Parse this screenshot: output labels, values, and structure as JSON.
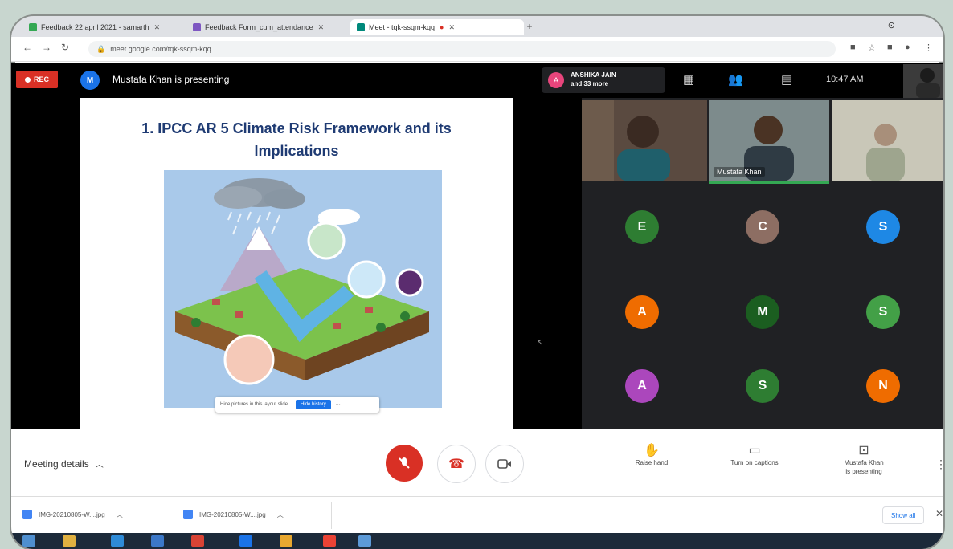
{
  "browser": {
    "tabs": [
      {
        "label": "Feedback 22 april 2021 - samarth",
        "fav": "#34a853"
      },
      {
        "label": "Feedback Form_cum_attendance",
        "fav": "#7e57c2"
      },
      {
        "label": "Meet - tqk-ssqm-kqq",
        "fav": "#00897b"
      }
    ],
    "url": "meet.google.com/tqk-ssqm-kqq"
  },
  "meet": {
    "rec_label": "REC",
    "presenter_initial": "M",
    "presenting_text": "Mustafa Khan is presenting",
    "chip_initial": "A",
    "chip_line1": "ANSHIKA JAIN",
    "chip_line2": "and 33 more",
    "clock": "10:47 AM"
  },
  "slide": {
    "title_line1": "1. IPCC AR 5 Climate Risk Framework and its",
    "title_line2": "Implications",
    "toolbar_label": "Hide pictures in this layout slide",
    "toolbar_button": "Hide history"
  },
  "gallery": {
    "video_tiles": [
      {
        "name": ""
      },
      {
        "name": "Mustafa Khan"
      },
      {
        "name": ""
      }
    ],
    "avatars": [
      {
        "initial": "E",
        "color": "#2e7d32"
      },
      {
        "initial": "C",
        "color": "#8d6e63"
      },
      {
        "initial": "S",
        "color": "#1e88e5"
      },
      {
        "initial": "A",
        "color": "#ef6c00"
      },
      {
        "initial": "M",
        "color": "#1b5e20"
      },
      {
        "initial": "S",
        "color": "#43a047"
      },
      {
        "initial": "A",
        "color": "#ab47bc"
      },
      {
        "initial": "S",
        "color": "#2e7d32"
      },
      {
        "initial": "N",
        "color": "#ef6c00"
      }
    ]
  },
  "controls": {
    "meeting_details": "Meeting details",
    "raise_hand": "Raise hand",
    "captions": "Turn on captions",
    "presenting_line1": "Mustafa Khan",
    "presenting_line2": "is presenting"
  },
  "downloads": {
    "items": [
      {
        "label": "IMG-20210805-W....jpg"
      },
      {
        "label": "IMG-20210805-W....jpg"
      }
    ],
    "show_all": "Show all"
  }
}
